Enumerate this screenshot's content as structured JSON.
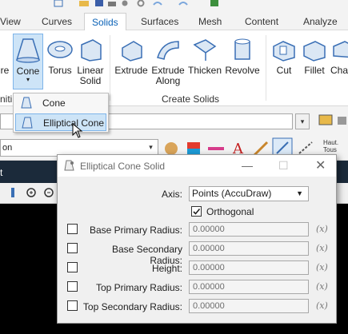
{
  "ribbon": {
    "tabs": [
      "View",
      "Curves",
      "Solids",
      "Surfaces",
      "Mesh",
      "Content",
      "Analyze"
    ],
    "active_tab": "Solids",
    "buttons": {
      "partial_left": "re",
      "cone": "Cone",
      "torus": "Torus",
      "linear_solid_1": "Linear",
      "linear_solid_2": "Solid",
      "extrude": "Extrude",
      "extrude_along_1": "Extrude",
      "extrude_along_2": "Along",
      "thicken": "Thicken",
      "revolve": "Revolve",
      "cut": "Cut",
      "fillet": "Fillet",
      "partial_right": "Cha"
    },
    "group_label": "Create Solids",
    "partial_group_left": "niti"
  },
  "cone_menu": {
    "items": [
      "Cone",
      "Elliptical Cone"
    ],
    "highlighted": "Elliptical Cone"
  },
  "toolbar": {
    "level_select": "on",
    "haut_label_1": "Haut.",
    "haut_label_2": "Tous"
  },
  "dialog": {
    "title": "Elliptical Cone Solid",
    "axis_label": "Axis:",
    "axis_value": "Points (AccuDraw)",
    "orthogonal_label": "Orthogonal",
    "orthogonal_checked": true,
    "fields": [
      {
        "label": "Base Primary Radius:",
        "value": "0.00000"
      },
      {
        "label": "Base Secondary Radius:",
        "value": "0.00000"
      },
      {
        "label": "Height:",
        "value": "0.00000"
      },
      {
        "label": "Top Primary Radius:",
        "value": "0.00000"
      },
      {
        "label": "Top Secondary Radius:",
        "value": "0.00000"
      }
    ],
    "expression_button": "(x)"
  },
  "colors": {
    "accent": "#0a62b7",
    "menu_highlight": "#cde4f7",
    "dialog_bg": "#f0f0f0"
  }
}
